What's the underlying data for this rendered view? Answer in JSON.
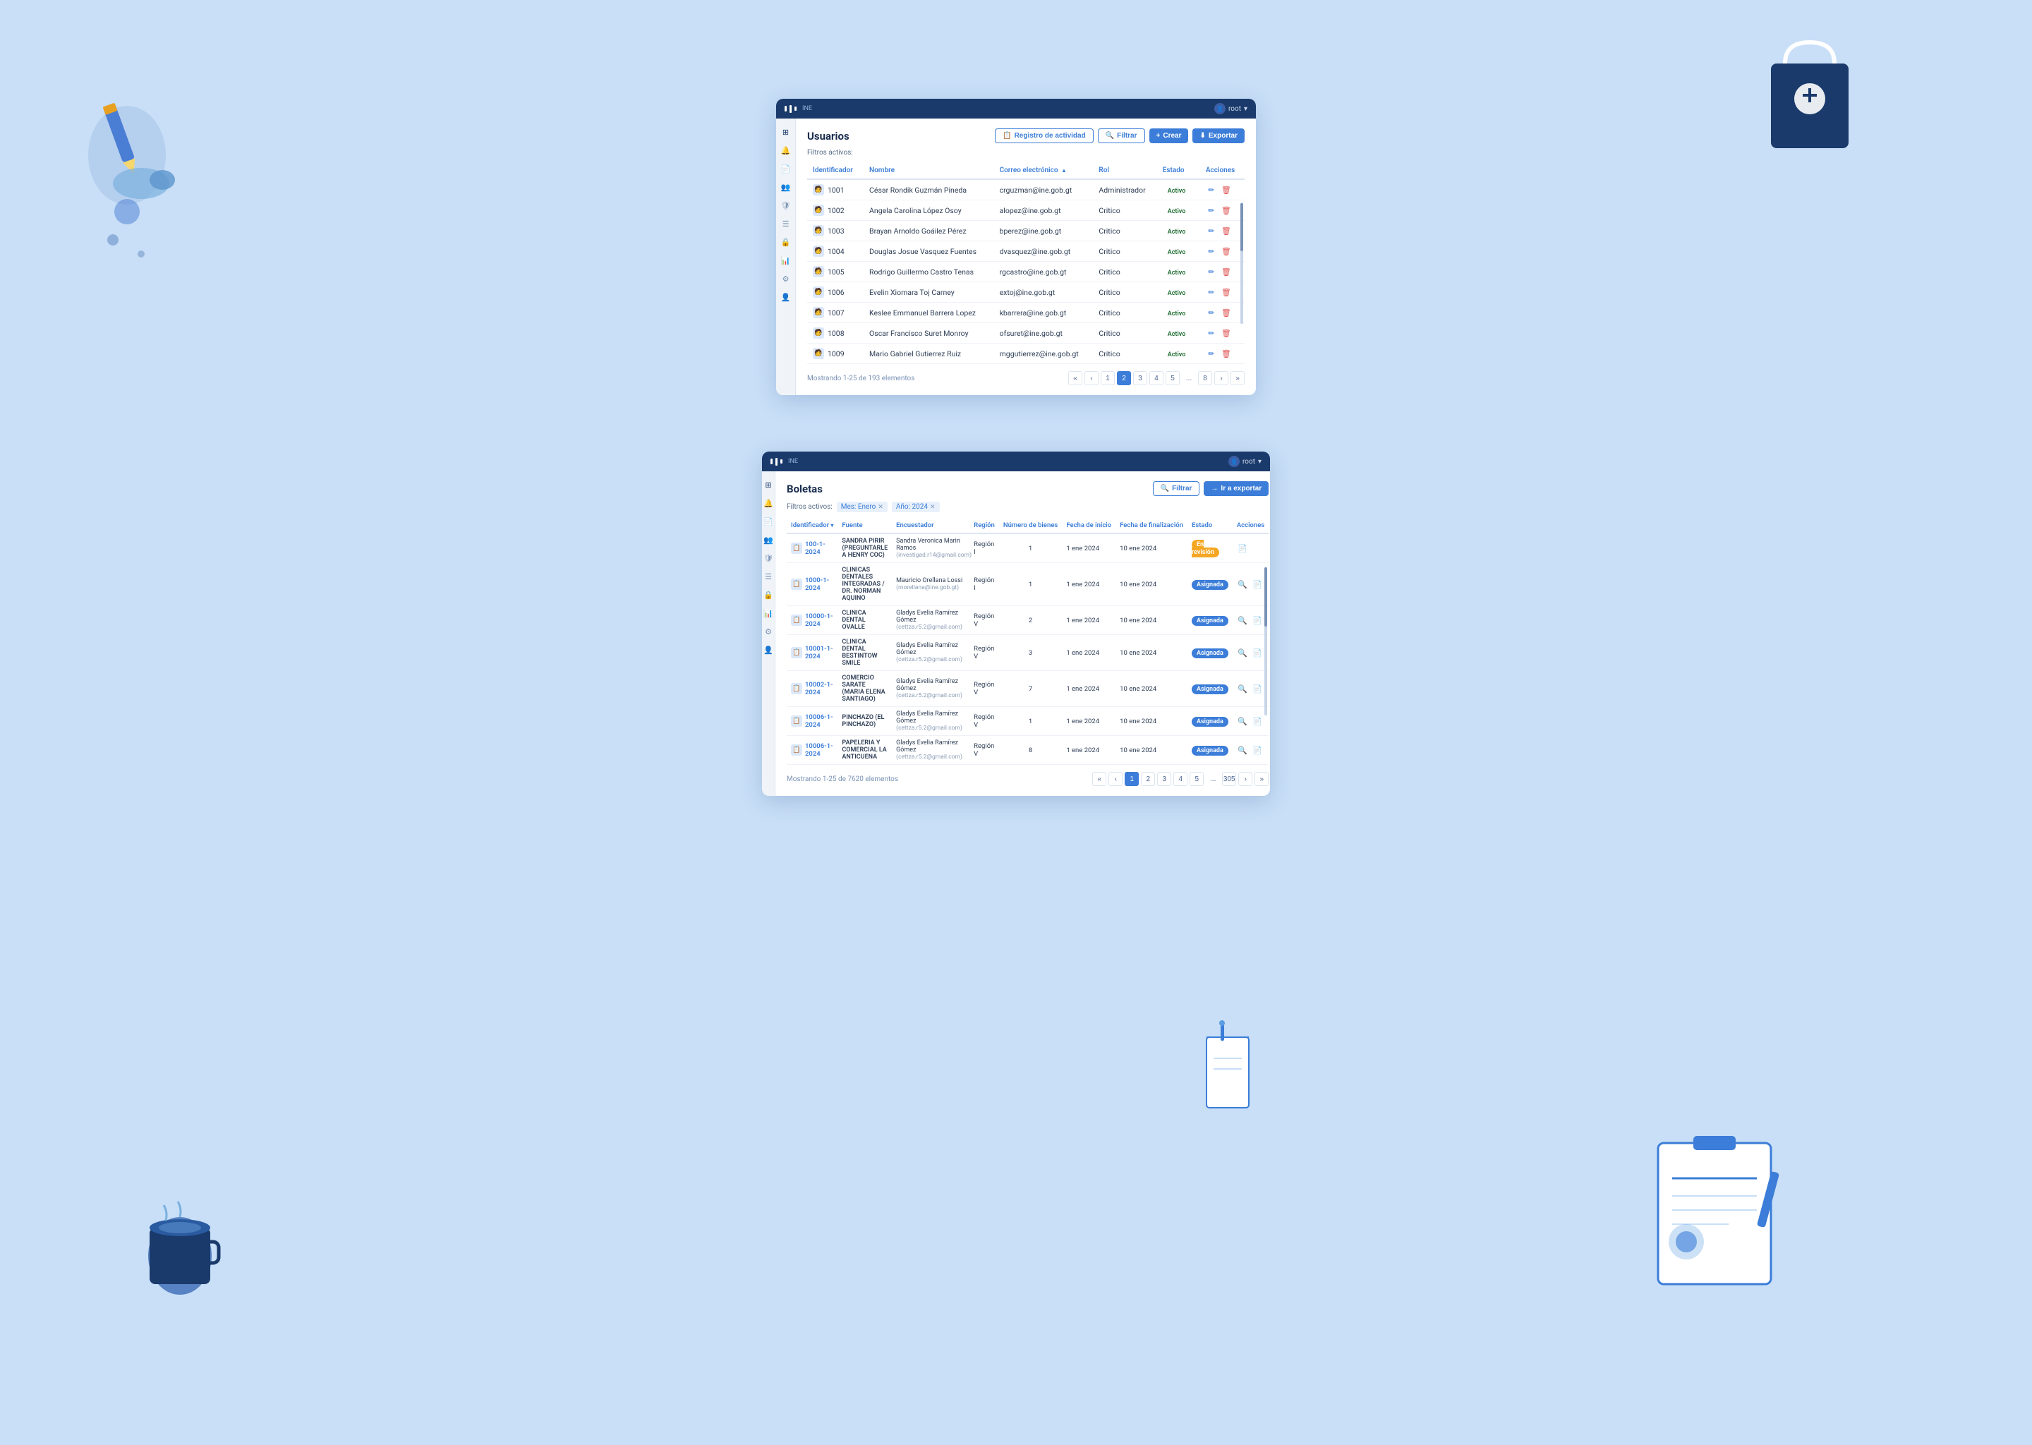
{
  "background": "#c8dff7",
  "window1": {
    "title": "Usuarios",
    "topbar": {
      "user_label": "root",
      "dropdown_arrow": "▾"
    },
    "buttons": {
      "registro": "Registro de actividad",
      "filtrar": "Filtrar",
      "crear": "Crear",
      "exportar": "Exportar"
    },
    "filters_label": "Filtros activos:",
    "columns": [
      "Identificador",
      "Nombre",
      "Correo electrónico",
      "Rol",
      "Estado",
      "Acciones"
    ],
    "sort_col": "Correo electrónico",
    "sort_dir": "▲",
    "rows": [
      {
        "id": "1001",
        "nombre": "César Rondik Guzmán Pineda",
        "email": "crguzman@ine.gob.gt",
        "rol": "Administrador",
        "estado": "Activo"
      },
      {
        "id": "1002",
        "nombre": "Angela Carolina López Osoy",
        "email": "alopez@ine.gob.gt",
        "rol": "Critico",
        "estado": "Activo"
      },
      {
        "id": "1003",
        "nombre": "Brayan Arnoldo Goáilez Pérez",
        "email": "bperez@ine.gob.gt",
        "rol": "Critico",
        "estado": "Activo"
      },
      {
        "id": "1004",
        "nombre": "Douglas Josue Vasquez Fuentes",
        "email": "dvasquez@ine.gob.gt",
        "rol": "Critico",
        "estado": "Activo"
      },
      {
        "id": "1005",
        "nombre": "Rodrigo Guillermo Castro Tenas",
        "email": "rgcastro@ine.gob.gt",
        "rol": "Critico",
        "estado": "Activo"
      },
      {
        "id": "1006",
        "nombre": "Evelin Xiomara Toj Carney",
        "email": "extoj@ine.gob.gt",
        "rol": "Critico",
        "estado": "Activo"
      },
      {
        "id": "1007",
        "nombre": "Keslee Emmanuel Barrera Lopez",
        "email": "kbarrera@ine.gob.gt",
        "rol": "Critico",
        "estado": "Activo"
      },
      {
        "id": "1008",
        "nombre": "Oscar Francisco Suret Monroy",
        "email": "ofsuret@ine.gob.gt",
        "rol": "Critico",
        "estado": "Activo"
      },
      {
        "id": "1009",
        "nombre": "Mario Gabriel Gutierrez Ruiz",
        "email": "mggutierrez@ine.gob.gt",
        "rol": "Critico",
        "estado": "Activo"
      }
    ],
    "pagination": {
      "showing": "Mostrando 1-25 de 193 elementos",
      "pages": [
        "«",
        "‹",
        "1",
        "2",
        "3",
        "4",
        "5",
        "...",
        "8",
        "›",
        "»"
      ],
      "active_page": "2"
    },
    "sidebar_icons": [
      "🏠",
      "🔔",
      "📄",
      "👥",
      "🛡",
      "📋",
      "🔒",
      "📊",
      "⚙",
      "👤"
    ]
  },
  "window2": {
    "title": "Boletas",
    "topbar": {
      "user_label": "root",
      "dropdown_arrow": "▾"
    },
    "buttons": {
      "filtrar": "Filtrar",
      "exportar": "Ir a exportar"
    },
    "filters_label": "Filtros activos:",
    "filter_mes": "Mes: Enero",
    "filter_anio": "Año: 2024",
    "columns": [
      "Identificador",
      "Fuente",
      "Encuestador",
      "Región",
      "Número de bienes",
      "Fecha de inicio",
      "Fecha de finalización",
      "Estado",
      "Acciones"
    ],
    "rows": [
      {
        "id": "100-1-2024",
        "fuente": "SANDRA PIRIR (PREGUNTARLE A HENRY COC)",
        "encuestador": "Sandra Veronica Marin Ramos",
        "encuestador_email": "(investigad.r14@gmail.com)",
        "region": "Región I",
        "bienes": "1",
        "fecha_inicio": "1 ene 2024",
        "fecha_fin": "10 ene 2024",
        "estado": "En revisión",
        "estado_type": "en-revision"
      },
      {
        "id": "1000-1-2024",
        "fuente": "CLINICAS DENTALES INTEGRADAS / DR. NORMAN AQUINO",
        "encuestador": "Mauricio Orellana Lossi",
        "encuestador_email": "(morellana@ine.gob.gt)",
        "region": "Región I",
        "bienes": "1",
        "fecha_inicio": "1 ene 2024",
        "fecha_fin": "10 ene 2024",
        "estado": "Asignada",
        "estado_type": "asignada"
      },
      {
        "id": "10000-1-2024",
        "fuente": "CLINICA DENTAL OVALLE",
        "encuestador": "Gladys Evelia Ramírez Gómez",
        "encuestador_email": "(cettza.r5.2@gmail.com)",
        "region": "Región V",
        "bienes": "2",
        "fecha_inicio": "1 ene 2024",
        "fecha_fin": "10 ene 2024",
        "estado": "Asignada",
        "estado_type": "asignada"
      },
      {
        "id": "10001-1-2024",
        "fuente": "CLINICA DENTAL BESTINTOW SMILE",
        "encuestador": "Gladys Evelia Ramírez Gómez",
        "encuestador_email": "(cettza.r5.2@gmail.com)",
        "region": "Región V",
        "bienes": "3",
        "fecha_inicio": "1 ene 2024",
        "fecha_fin": "10 ene 2024",
        "estado": "Asignada",
        "estado_type": "asignada"
      },
      {
        "id": "10002-1-2024",
        "fuente": "COMERCIO SARATE (MARIA ELENA SANTIAGO)",
        "encuestador": "Gladys Evelia Ramírez Gómez",
        "encuestador_email": "(cettza.r5.2@gmail.com)",
        "region": "Región V",
        "bienes": "7",
        "fecha_inicio": "1 ene 2024",
        "fecha_fin": "10 ene 2024",
        "estado": "Asignada",
        "estado_type": "asignada"
      },
      {
        "id": "10006-1-2024",
        "fuente": "PINCHAZO (EL PINCHAZO)",
        "encuestador": "Gladys Evelia Ramírez Gómez",
        "encuestador_email": "(cettza.r5.2@gmail.com)",
        "region": "Región V",
        "bienes": "1",
        "fecha_inicio": "1 ene 2024",
        "fecha_fin": "10 ene 2024",
        "estado": "Asignada",
        "estado_type": "asignada"
      },
      {
        "id": "10006-1-2024",
        "fuente": "PAPELERIA Y COMERCIAL LA ANTICUENA",
        "encuestador": "Gladys Evelia Ramírez Gómez",
        "encuestador_email": "(cettza.r5.2@gmail.com)",
        "region": "Región V",
        "bienes": "8",
        "fecha_inicio": "1 ene 2024",
        "fecha_fin": "10 ene 2024",
        "estado": "Asignada",
        "estado_type": "asignada"
      }
    ],
    "pagination": {
      "showing": "Mostrando 1-25 de 7620 elementos",
      "pages": [
        "«",
        "‹",
        "1",
        "2",
        "3",
        "4",
        "5",
        "...",
        "305",
        "›",
        "»"
      ],
      "active_page": "1"
    },
    "sidebar_icons": [
      "🏠",
      "🔔",
      "📄",
      "👥",
      "🛡",
      "📋",
      "🔒",
      "📊",
      "⚙",
      "👤"
    ]
  }
}
